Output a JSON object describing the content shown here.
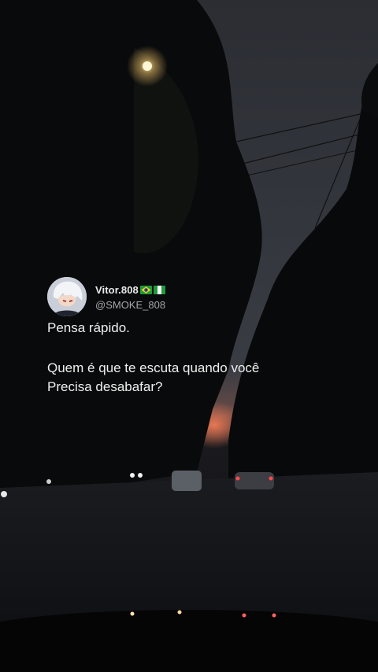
{
  "tweet": {
    "display_name": "Vitor.808",
    "handle": "@SMOKE_808",
    "flags": [
      "brazil-flag-icon",
      "nigeria-flag-icon"
    ],
    "lines": [
      "Pensa rápido.",
      "Quem é que te escuta quando você",
      "Precisa desabafar?"
    ]
  },
  "colors": {
    "sky": "#2a2c33",
    "sunset": "#e06a4a",
    "text": "#efefef",
    "handle": "#a6a6a6"
  }
}
